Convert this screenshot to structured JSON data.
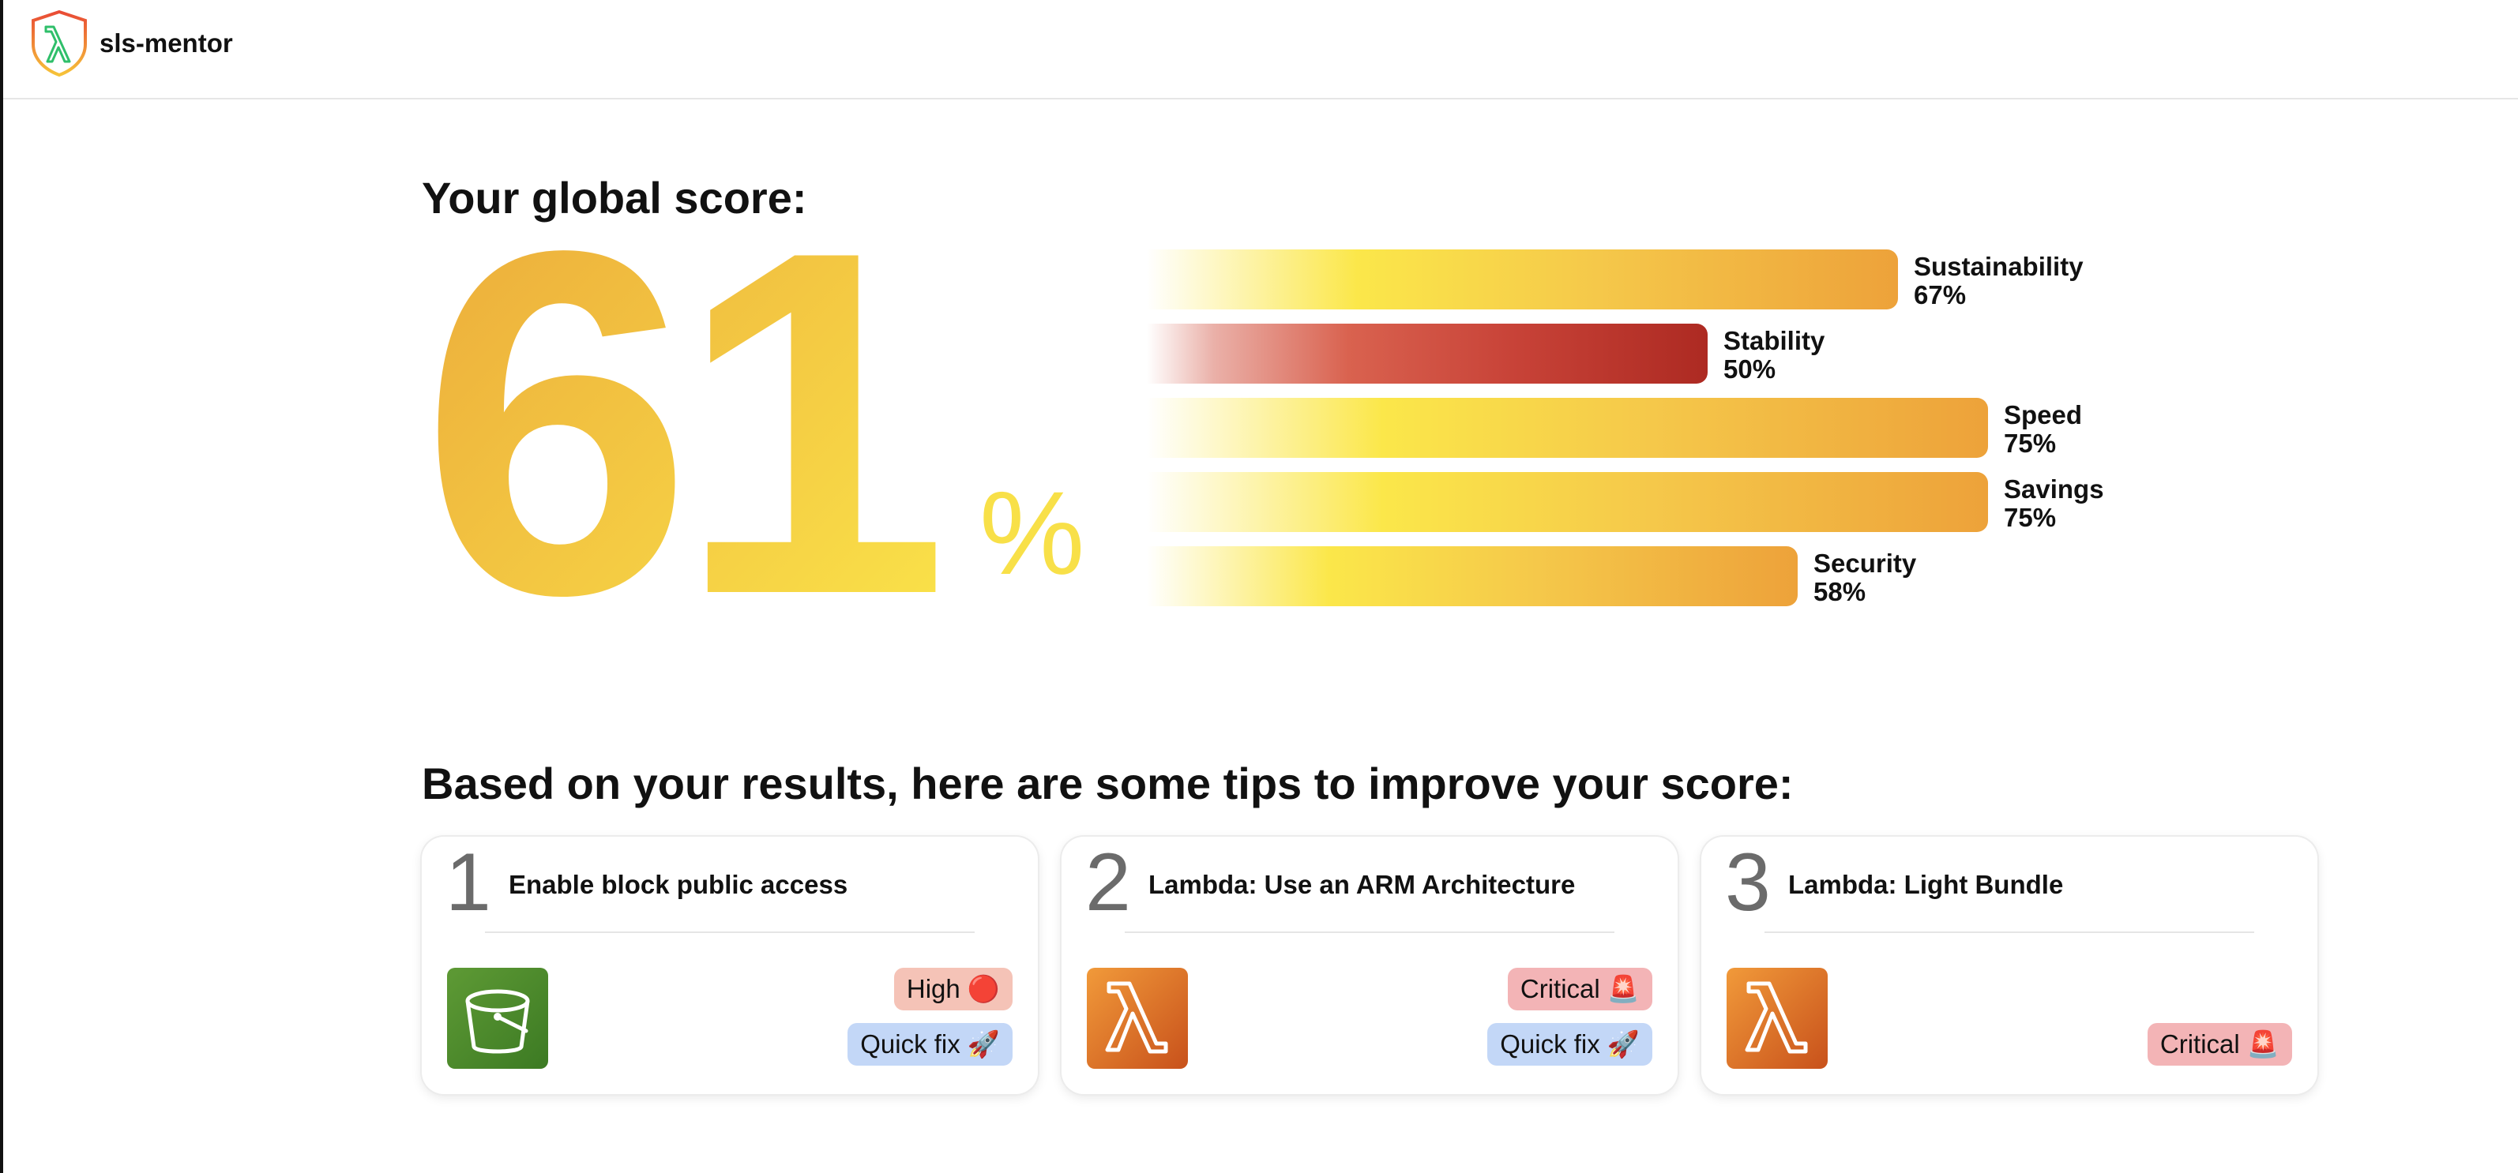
{
  "header": {
    "app_title": "sls-mentor",
    "logo_icon": "sls-mentor-shield-lambda-logo"
  },
  "score": {
    "heading": "Your global score:",
    "value": "61",
    "percent_sign": "%",
    "value_number": 61,
    "colors": {
      "start": "#eba83a",
      "end": "#fbe64a"
    }
  },
  "categories": [
    {
      "name": "Sustainability",
      "value_text": "67%",
      "value": 67,
      "color": "gold"
    },
    {
      "name": "Stability",
      "value_text": "50%",
      "value": 50,
      "color": "red"
    },
    {
      "name": "Speed",
      "value_text": "75%",
      "value": 75,
      "color": "gold"
    },
    {
      "name": "Savings",
      "value_text": "75%",
      "value": 75,
      "color": "gold"
    },
    {
      "name": "Security",
      "value_text": "58%",
      "value": 58,
      "color": "gold"
    }
  ],
  "tips": {
    "heading": "Based on your results, here are some tips to improve your score:",
    "cards": [
      {
        "number": "1",
        "title": "Enable block public access",
        "service_icon": "s3-bucket-icon",
        "severity": "High 🔴",
        "quick_fix": "Quick fix 🚀"
      },
      {
        "number": "2",
        "title": "Lambda: Use an ARM Architecture",
        "service_icon": "lambda-icon",
        "severity": "Critical 🚨",
        "quick_fix": "Quick fix 🚀"
      },
      {
        "number": "3",
        "title": "Lambda: Light Bundle",
        "service_icon": "lambda-icon",
        "severity": "Critical 🚨"
      }
    ]
  },
  "colors": {
    "gold_bar_end": "#eda23a",
    "red_bar_end": "#ad2a22",
    "badge_high": "#f5c3b7",
    "badge_critical": "#f3b4b6",
    "badge_quick_fix": "#c3d7f7",
    "s3_green": "#4a8a2c",
    "lambda_orange": "#e07a2a"
  }
}
